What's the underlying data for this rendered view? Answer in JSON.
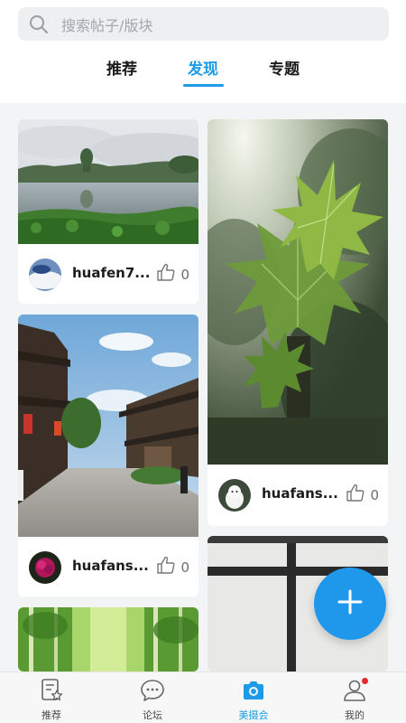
{
  "search": {
    "placeholder": "搜索帖子/版块"
  },
  "tabs": [
    {
      "label": "推荐",
      "active": false
    },
    {
      "label": "发现",
      "active": true
    },
    {
      "label": "专题",
      "active": false
    }
  ],
  "posts": [
    {
      "username": "huafen7...",
      "likes": "0"
    },
    {
      "username": "huafans...",
      "likes": "0"
    },
    {
      "username": "huafans...",
      "likes": "0"
    }
  ],
  "bottom_nav": [
    {
      "label": "推荐",
      "icon": "post-star-icon",
      "active": false
    },
    {
      "label": "论坛",
      "icon": "chat-bubble-icon",
      "active": false
    },
    {
      "label": "美摄会",
      "icon": "camera-icon",
      "active": true
    },
    {
      "label": "我的",
      "icon": "person-icon",
      "active": false,
      "badge": true
    }
  ],
  "colors": {
    "accent": "#1d9be8",
    "fab": "#1f98ec",
    "badge": "#e8262a"
  }
}
